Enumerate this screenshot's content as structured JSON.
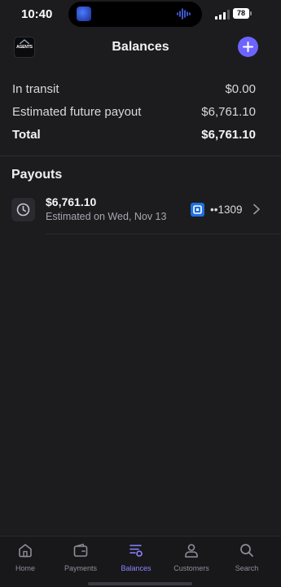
{
  "status_bar": {
    "time": "10:40",
    "battery": "78"
  },
  "header": {
    "title": "Balances",
    "logo_text": "AGENTS",
    "add_icon": "plus-icon"
  },
  "summary": {
    "rows": [
      {
        "label": "In transit",
        "value": "$0.00"
      },
      {
        "label": "Estimated future payout",
        "value": "$6,761.10"
      },
      {
        "label": "Total",
        "value": "$6,761.10"
      }
    ]
  },
  "payouts": {
    "title": "Payouts",
    "items": [
      {
        "amount": "$6,761.10",
        "date": "Estimated on Wed, Nov 13",
        "account": "••1309",
        "icon": "clock-icon"
      }
    ]
  },
  "tab_bar": {
    "active": "Balances",
    "accent": "#6d63ff",
    "tabs": [
      {
        "label": "Home",
        "icon": "home-icon"
      },
      {
        "label": "Payments",
        "icon": "wallet-icon"
      },
      {
        "label": "Balances",
        "icon": "balances-icon"
      },
      {
        "label": "Customers",
        "icon": "person-icon"
      },
      {
        "label": "Search",
        "icon": "search-icon"
      }
    ]
  }
}
